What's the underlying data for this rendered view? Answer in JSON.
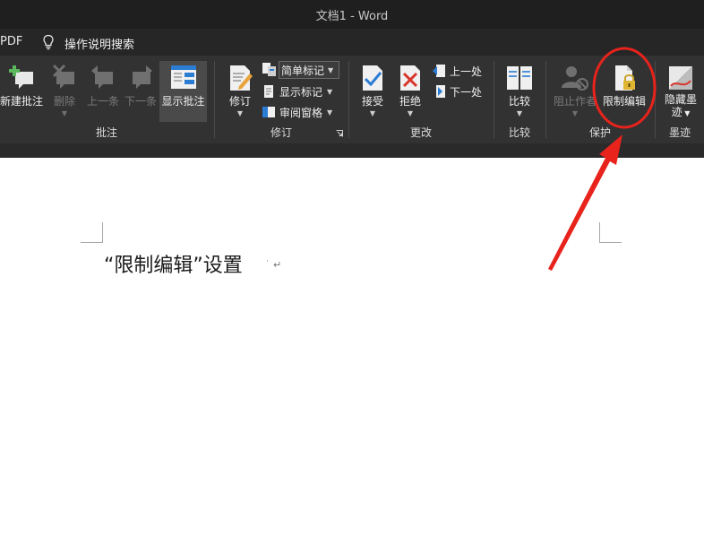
{
  "window": {
    "title": "文档1  -  Word"
  },
  "menubar": {
    "pdf_tab": "PDF",
    "tell_me": "操作说明搜索"
  },
  "ribbon": {
    "comments_group": {
      "label": "批注",
      "new_comment": "新建批注",
      "delete": "删除",
      "previous": "上一条",
      "next": "下一条",
      "show_comments": "显示批注"
    },
    "tracking_group": {
      "label": "修订",
      "track_changes": "修订",
      "markup_mode": "简单标记",
      "show_markup": "显示标记",
      "reviewing_pane": "审阅窗格"
    },
    "changes_group": {
      "label": "更改",
      "accept": "接受",
      "reject": "拒绝",
      "previous": "上一处",
      "next": "下一处"
    },
    "compare_group": {
      "label": "比较",
      "compare": "比较"
    },
    "protect_group": {
      "label": "保护",
      "block_authors": "阻止作者",
      "restrict_editing": "限制编辑"
    },
    "ink_group": {
      "label": "墨迹",
      "hide_ink_line1": "隐藏墨",
      "hide_ink_line2": "迹"
    }
  },
  "document": {
    "body_text": "“限制编辑”设置"
  },
  "colors": {
    "ribbon_bg": "#323232",
    "annotation_red": "#e8231c",
    "accent_blue": "#2b7cd3"
  }
}
